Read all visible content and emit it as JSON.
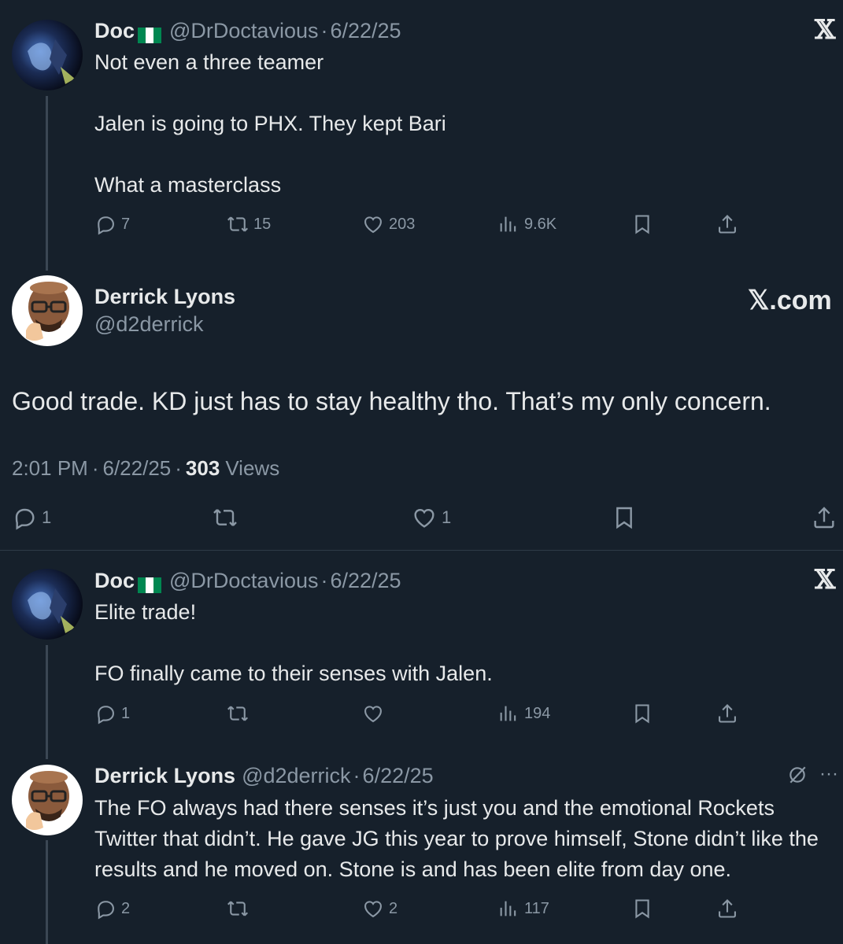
{
  "tweet1": {
    "name": "Doc",
    "handle": "@DrDoctavious",
    "date": "6/22/25",
    "body": "Not even a three teamer\n\nJalen is going to PHX. They kept Bari\n\nWhat a masterclass",
    "replies": "7",
    "retweets": "15",
    "likes": "203",
    "views": "9.6K",
    "logo": "𝕏"
  },
  "main": {
    "name": "Derrick Lyons",
    "handle": "@d2derrick",
    "logo": "𝕏.com",
    "body": "Good trade. KD just has to stay healthy tho. That’s my only concern.",
    "time": "2:01 PM",
    "date": "6/22/25",
    "views_count": "303",
    "views_label": "Views",
    "replies": "1",
    "likes": "1"
  },
  "tweet2": {
    "name": "Doc",
    "handle": "@DrDoctavious",
    "date": "6/22/25",
    "body": "Elite trade!\n\nFO finally came to their senses with Jalen.",
    "replies": "1",
    "views": "194",
    "logo": "𝕏"
  },
  "tweet3": {
    "name": "Derrick Lyons",
    "handle": "@d2derrick",
    "date": "6/22/25",
    "body": "The FO always had there senses it’s just you and the emotional Rockets Twitter that didn’t. He gave JG this year to prove himself, Stone didn’t like the results and he moved on. Stone is and has been elite from day one.",
    "replies": "2",
    "likes": "2",
    "views": "117",
    "more": "···"
  },
  "separator": "·",
  "colors": {
    "background": "#16202b",
    "text": "#e7e9ea",
    "muted": "#8b98a5",
    "nigeria_green": "#008751"
  }
}
